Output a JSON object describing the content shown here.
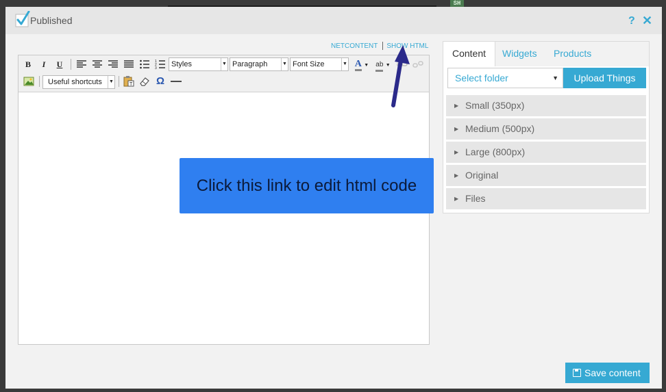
{
  "background": {
    "tag_label": "SH"
  },
  "modal": {
    "status_label": "Published",
    "help_glyph": "?",
    "close_glyph": "✕"
  },
  "editor": {
    "links": {
      "netcontent": "NETCONTENT",
      "show_html": "SHOW HTML"
    },
    "toolbar": {
      "bold": "B",
      "italic": "I",
      "underline": "U",
      "styles_value": "Styles",
      "format_value": "Paragraph",
      "font_size_value": "Font Size",
      "font_color_glyph": "A",
      "highlight_glyph": "ab",
      "shortcuts_value": "Useful shortcuts",
      "omega_glyph": "Ω"
    },
    "callout_text": "Click this link to edit html code"
  },
  "side_panel": {
    "tabs": [
      {
        "label": "Content",
        "active": true
      },
      {
        "label": "Widgets",
        "active": false
      },
      {
        "label": "Products",
        "active": false
      }
    ],
    "folder_select": {
      "value": "Select folder"
    },
    "upload_label": "Upload Things",
    "sizes": [
      {
        "label": "Small (350px)"
      },
      {
        "label": "Medium (500px)"
      },
      {
        "label": "Large (800px)"
      },
      {
        "label": "Original"
      },
      {
        "label": "Files"
      }
    ]
  },
  "footer": {
    "save_label": "Save content"
  },
  "colors": {
    "accent": "#36a9d3",
    "callout": "#2f7ff0",
    "arrow": "#2b2a8a"
  }
}
